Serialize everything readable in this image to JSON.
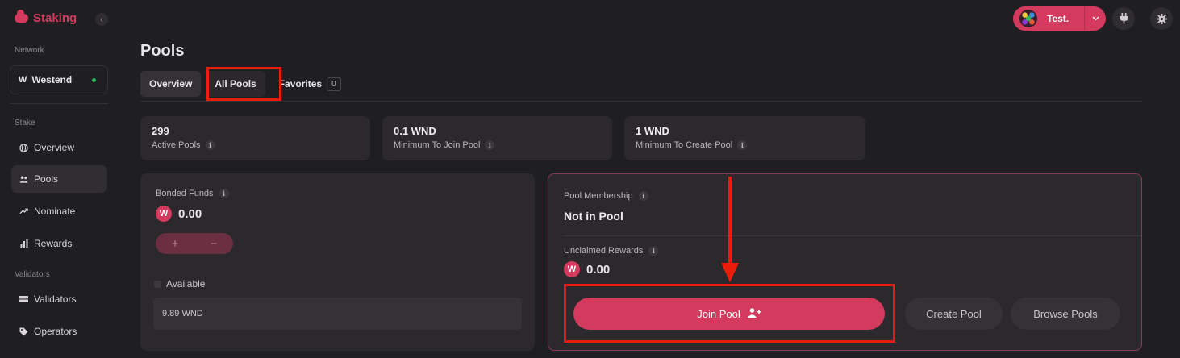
{
  "app": {
    "name": "Staking",
    "collapse_icon": "‹"
  },
  "sidebar": {
    "network_label": "Network",
    "network": {
      "mark": "W",
      "name": "Westend"
    },
    "sections": [
      {
        "label": "Stake"
      },
      {
        "label": "Validators"
      }
    ],
    "items": [
      {
        "label": "Overview",
        "icon": "globe-icon"
      },
      {
        "label": "Pools",
        "icon": "users-icon"
      },
      {
        "label": "Nominate",
        "icon": "trend-up-icon"
      },
      {
        "label": "Rewards",
        "icon": "bar-chart-icon"
      },
      {
        "label": "Validators",
        "icon": "server-icon"
      },
      {
        "label": "Operators",
        "icon": "tag-icon"
      }
    ]
  },
  "header": {
    "title": "Pools",
    "tabs": [
      {
        "label": "Overview"
      },
      {
        "label": "All Pools"
      },
      {
        "label": "Favorites",
        "count": "0"
      }
    ],
    "account": {
      "name": "Test."
    }
  },
  "stats": [
    {
      "value": "299",
      "label": "Active Pools"
    },
    {
      "value": "0.1 WND",
      "label": "Minimum To Join Pool"
    },
    {
      "value": "1 WND",
      "label": "Minimum To Create Pool"
    }
  ],
  "bonded": {
    "label": "Bonded Funds",
    "token_mark": "W",
    "amount": "0.00",
    "plus": "+",
    "minus": "−",
    "available_label": "Available",
    "available_value": "9.89 WND"
  },
  "membership": {
    "label": "Pool Membership",
    "status": "Not in Pool",
    "rewards_label": "Unclaimed Rewards",
    "token_mark": "W",
    "rewards_amount": "0.00",
    "join_label": "Join Pool",
    "create_label": "Create Pool",
    "browse_label": "Browse Pools"
  },
  "colors": {
    "accent": "#d33a5e",
    "annotation": "#ea1c0a",
    "background": "#1f1e20",
    "card": "#2b292c"
  }
}
